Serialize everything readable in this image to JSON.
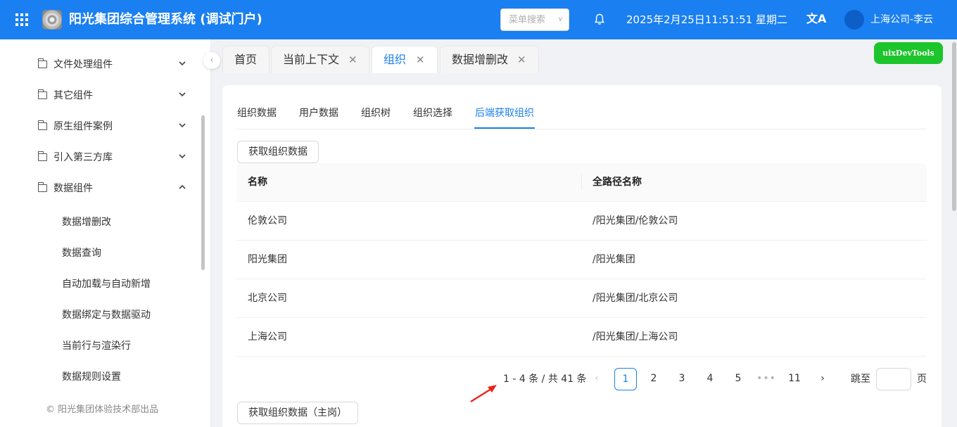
{
  "header": {
    "title": "阳光集团综合管理系统 (调试门户)",
    "menu_search_placeholder": "菜单搜索",
    "datetime": "2025年2月25日11:51:51 星期二",
    "translate_glyph": "文A",
    "user": "上海公司-李云",
    "bg_color": "#1a7ff0"
  },
  "sidebar": {
    "groups": [
      {
        "label": "文件处理组件",
        "expanded": false
      },
      {
        "label": "其它组件",
        "expanded": false
      },
      {
        "label": "原生组件案例",
        "expanded": false
      },
      {
        "label": "引入第三方库",
        "expanded": false
      },
      {
        "label": "数据组件",
        "expanded": true
      }
    ],
    "sub_items": [
      "数据增删改",
      "数据查询",
      "自动加载与自动新增",
      "数据绑定与数据驱动",
      "当前行与渲染行",
      "数据规则设置"
    ],
    "footer": "© 阳光集团体验技术部出品"
  },
  "tabs": [
    {
      "label": "首页",
      "closable": false
    },
    {
      "label": "当前上下文",
      "closable": true
    },
    {
      "label": "组织",
      "closable": true,
      "active": true
    },
    {
      "label": "数据增删改",
      "closable": true
    }
  ],
  "devtools_label": "uixDevTools",
  "sub_tabs": [
    "组织数据",
    "用户数据",
    "组织树",
    "组织选择",
    "后端获取组织"
  ],
  "active_sub_tab": "后端获取组织",
  "fetch_button": "获取组织数据",
  "fetch_main_button": "获取组织数据（主岗）",
  "table": {
    "columns": [
      "名称",
      "全路径名称"
    ],
    "rows": [
      [
        "伦敦公司",
        "/阳光集团/伦敦公司"
      ],
      [
        "阳光集团",
        "/阳光集团"
      ],
      [
        "北京公司",
        "/阳光集团/北京公司"
      ],
      [
        "上海公司",
        "/阳光集团/上海公司"
      ]
    ]
  },
  "pagination": {
    "total_text": "1 - 4 条 / 共 41 条",
    "pages": [
      "1",
      "2",
      "3",
      "4",
      "5"
    ],
    "ellipsis": "•••",
    "last_page": "11",
    "current": "1",
    "jump_label": "跳至",
    "jump_unit": "页"
  },
  "icons": {
    "prev": "‹",
    "next": "›",
    "close": "✕",
    "collapse": "‹",
    "chevron": "∨"
  }
}
